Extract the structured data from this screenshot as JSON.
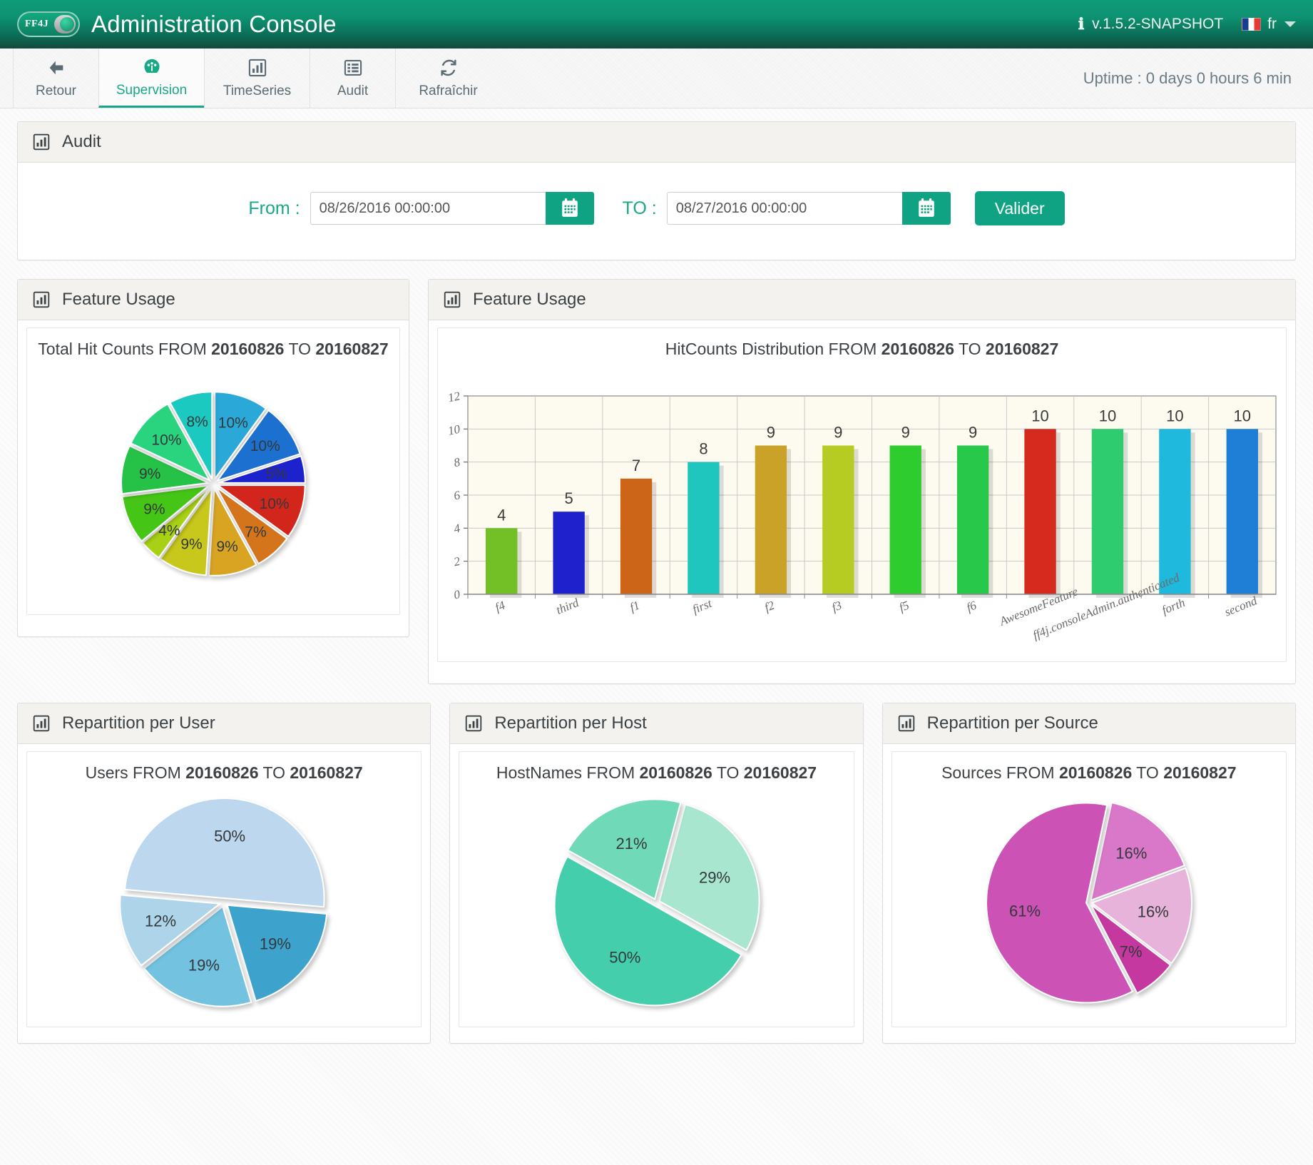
{
  "header": {
    "logo_text": "FF4J",
    "title": "Administration Console",
    "version": "v.1.5.2-SNAPSHOT",
    "info_icon": "info-icon",
    "language": "fr",
    "flag_icon": "france-flag-icon"
  },
  "nav": {
    "items": [
      {
        "label": "Retour",
        "icon": "arrow-left-icon",
        "active": false
      },
      {
        "label": "Supervision",
        "icon": "dashboard-gauge-icon",
        "active": true
      },
      {
        "label": "TimeSeries",
        "icon": "bar-chart-icon",
        "active": false
      },
      {
        "label": "Audit",
        "icon": "list-icon",
        "active": false
      },
      {
        "label": "Rafraîchir",
        "icon": "refresh-icon",
        "active": false
      }
    ],
    "uptime": "Uptime : 0 days 0 hours 6 min"
  },
  "audit_panel": {
    "title": "Audit",
    "icon": "bar-chart-icon",
    "from_label": "From :",
    "from_value": "08/26/2016 00:00:00",
    "to_label": "TO :",
    "to_value": "08/27/2016 00:00:00",
    "calendar_icon": "calendar-icon",
    "submit_label": "Valider"
  },
  "panels": {
    "feature_usage_pie": {
      "title": "Feature Usage",
      "icon": "bar-chart-icon"
    },
    "feature_usage_bar": {
      "title": "Feature Usage",
      "icon": "bar-chart-icon"
    },
    "per_user": {
      "title": "Repartition per User",
      "icon": "bar-chart-icon"
    },
    "per_host": {
      "title": "Repartition per Host",
      "icon": "bar-chart-icon"
    },
    "per_source": {
      "title": "Repartition per Source",
      "icon": "bar-chart-icon"
    }
  },
  "chart_data": [
    {
      "id": "total_hit_counts_pie",
      "type": "pie",
      "title": "Total Hit Counts FROM 20160826 TO 20160827",
      "title_prefix": "Total Hit Counts FROM ",
      "date_from": "20160826",
      "title_mid": " TO ",
      "date_to": "20160827",
      "labels": [
        "10%",
        "10%",
        "5%",
        "10%",
        "7%",
        "9%",
        "9%",
        "4%",
        "9%",
        "9%",
        "10%",
        "8%"
      ],
      "values": [
        10,
        10,
        5,
        10,
        7,
        9,
        9,
        4,
        9,
        9,
        10,
        8
      ],
      "colors": [
        "#2aa8d8",
        "#1f6fd0",
        "#1f22cc",
        "#d2251f",
        "#d4741c",
        "#d8a420",
        "#c8c81e",
        "#a8d118",
        "#45c616",
        "#27c247",
        "#2bd47e",
        "#1fc9c0"
      ],
      "legend": false
    },
    {
      "id": "hitcounts_distribution_bar",
      "type": "bar",
      "title": "HitCounts Distribution FROM 20160826 TO 20160827",
      "title_prefix": "HitCounts Distribution FROM ",
      "date_from": "20160826",
      "title_mid": " TO ",
      "date_to": "20160827",
      "categories": [
        "f4",
        "third",
        "f1",
        "first",
        "f2",
        "f3",
        "f5",
        "f6",
        "AwesomeFeature",
        "ff4j.consoleAdmin.authenticated",
        "forth",
        "second"
      ],
      "values": [
        4,
        5,
        7,
        8,
        9,
        9,
        9,
        9,
        10,
        10,
        10,
        10
      ],
      "colors": [
        "#72bf26",
        "#1f22cc",
        "#cc6518",
        "#1ec6bd",
        "#c9a227",
        "#b6cc22",
        "#2ecc2e",
        "#28c84a",
        "#d62a1e",
        "#2ecc6f",
        "#1fb9dd",
        "#1f7fd6"
      ],
      "ylim": [
        0,
        12
      ],
      "yticks": [
        0,
        2,
        4,
        6,
        8,
        10,
        12
      ],
      "xlabel": "",
      "ylabel": "",
      "grid": true,
      "legend": false,
      "plot_bg": "#fdfbf0"
    },
    {
      "id": "users_pie",
      "type": "pie",
      "title": "Users FROM 20160826 TO 20160827",
      "title_prefix": "Users FROM ",
      "date_from": "20160826",
      "title_mid": " TO ",
      "date_to": "20160827",
      "labels": [
        "50%",
        "19%",
        "19%",
        "12%"
      ],
      "values": [
        50,
        19,
        19,
        12
      ],
      "colors": [
        "#bdd7ee",
        "#3ca3cc",
        "#72c2e0",
        "#aed4ea"
      ],
      "legend": false
    },
    {
      "id": "hostnames_pie",
      "type": "pie",
      "title": "HostNames FROM 20160826 TO 20160827",
      "title_prefix": "HostNames FROM ",
      "date_from": "20160826",
      "title_mid": " TO ",
      "date_to": "20160827",
      "labels": [
        "29%",
        "50%",
        "21%"
      ],
      "values": [
        29,
        50,
        21
      ],
      "colors": [
        "#a8e6cf",
        "#45ceab",
        "#6fd9b8"
      ],
      "legend": false
    },
    {
      "id": "sources_pie",
      "type": "pie",
      "title": "Sources FROM 20160826 TO 20160827",
      "title_prefix": "Sources FROM ",
      "date_from": "20160826",
      "title_mid": " TO ",
      "date_to": "20160827",
      "labels": [
        "16%",
        "16%",
        "7%",
        "61%"
      ],
      "values": [
        16,
        16,
        7,
        61
      ],
      "colors": [
        "#d978c8",
        "#e8b3da",
        "#c4379f",
        "#cc52b5"
      ],
      "legend": false
    }
  ],
  "colors": {
    "accent": "#0fa383",
    "header_dark": "#14483c",
    "panel_head": "#f4f2ee"
  }
}
